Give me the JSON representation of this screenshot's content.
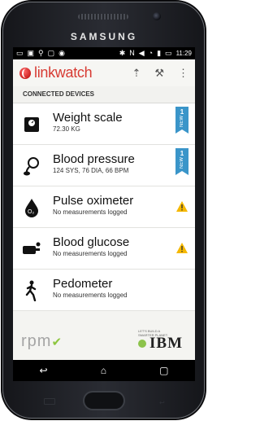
{
  "device": {
    "brand": "SAMSUNG"
  },
  "status_bar": {
    "time": "11:29"
  },
  "app": {
    "logo_text": "linkwatch",
    "colors": {
      "brand": "#d73a32",
      "badge": "#3a95c9",
      "warning": "#f5b800"
    },
    "actions": {
      "upload_icon": "upload-icon",
      "settings_icon": "wrench-icon",
      "menu_icon": "overflow-menu-icon"
    }
  },
  "section": {
    "title": "CONNECTED DEVICES"
  },
  "devices": [
    {
      "name": "Weight scale",
      "detail": "72.30 KG",
      "badge": {
        "count": "1",
        "label": "NEW"
      }
    },
    {
      "name": "Blood pressure",
      "detail": "124 SYS, 76 DIA, 66 BPM",
      "badge": {
        "count": "1",
        "label": "NEW"
      }
    },
    {
      "name": "Pulse oximeter",
      "detail": "No measurements logged",
      "status_icon": "warning-icon"
    },
    {
      "name": "Blood glucose",
      "detail": "No measurements logged",
      "status_icon": "warning-icon"
    },
    {
      "name": "Pedometer",
      "detail": "No measurements logged"
    }
  ],
  "footer": {
    "left_logo": "rpm",
    "partner_tagline": "LET'S BUILD A SMARTER PLANET.",
    "partner_logo": "IBM"
  },
  "nav": {
    "back": "↩",
    "home": "⌂",
    "recents": "▢"
  }
}
